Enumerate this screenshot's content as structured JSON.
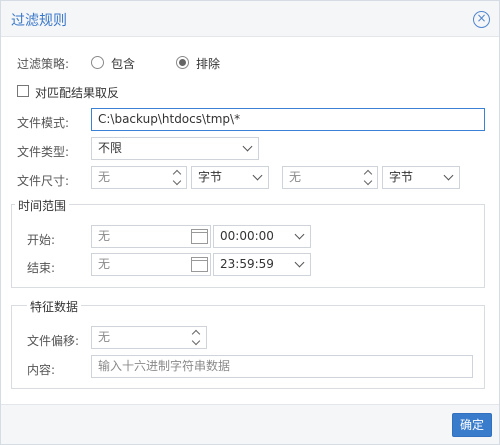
{
  "dialog": {
    "title": "过滤规则",
    "close_icon": "close-circle-icon"
  },
  "strategy": {
    "label": "过滤策略:",
    "options": [
      {
        "label": "包含",
        "selected": false
      },
      {
        "label": "排除",
        "selected": true
      }
    ]
  },
  "invert": {
    "label": "对匹配结果取反",
    "checked": false
  },
  "file_pattern": {
    "label": "文件模式:",
    "value": "C:\\backup\\htdocs\\tmp\\*"
  },
  "file_type": {
    "label": "文件类型:",
    "value": "不限"
  },
  "file_size": {
    "label": "文件尺寸:",
    "min_value": "无",
    "min_unit": "字节",
    "max_value": "无",
    "max_unit": "字节"
  },
  "time_range": {
    "legend": "时间范围",
    "start_label": "开始:",
    "start_date": "无",
    "start_time": "00:00:00",
    "end_label": "结束:",
    "end_date": "无",
    "end_time": "23:59:59"
  },
  "signature": {
    "legend": "特征数据",
    "offset_label": "文件偏移:",
    "offset_value": "无",
    "content_label": "内容:",
    "content_placeholder": "输入十六进制字符串数据"
  },
  "footer": {
    "ok_label": "确定"
  },
  "colors": {
    "accent": "#3a7ccc",
    "title": "#3a78c9",
    "active_border": "#3b82d6"
  }
}
